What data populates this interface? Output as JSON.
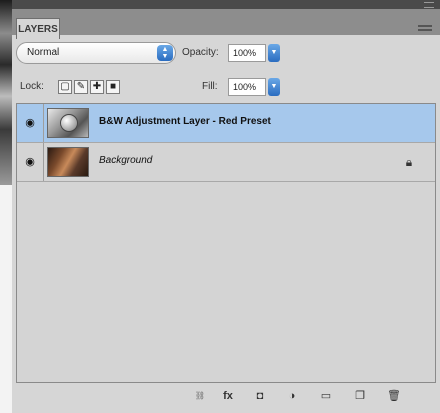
{
  "panel": {
    "tab_label": "LAYERS"
  },
  "controls": {
    "blend_mode": "Normal",
    "opacity_label": "Opacity:",
    "opacity_value": "100%",
    "lock_label": "Lock:",
    "fill_label": "Fill:",
    "fill_value": "100%"
  },
  "layers": [
    {
      "name": "B&W Adjustment Layer - Red Preset",
      "selected": true,
      "visible": true,
      "thumb": "adjustment"
    },
    {
      "name": "Background",
      "selected": false,
      "visible": true,
      "thumb": "photo",
      "locked": true
    }
  ],
  "bottom_icons": [
    "link-icon",
    "fx-icon",
    "mask-icon",
    "adjustment-icon",
    "group-icon",
    "new-layer-icon",
    "trash-icon"
  ],
  "colors": {
    "selection": "#a6c8ec",
    "accent": "#2a6cc0"
  }
}
